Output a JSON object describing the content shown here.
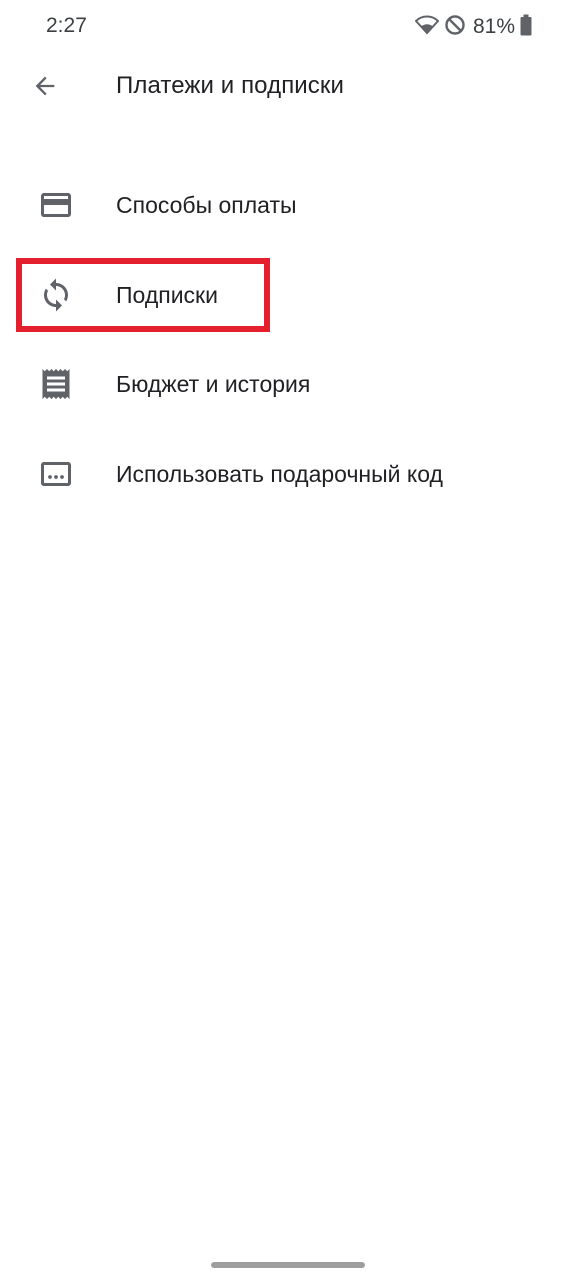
{
  "status_bar": {
    "time": "2:27",
    "battery": "81%",
    "icons": [
      "wifi-icon",
      "do-not-disturb-icon",
      "battery-icon"
    ]
  },
  "app_bar": {
    "back_icon": "arrow-back-icon",
    "title": "Платежи и подписки"
  },
  "menu": {
    "items": [
      {
        "label": "Способы оплаты",
        "icon": "credit-card-icon"
      },
      {
        "label": "Подписки",
        "icon": "sync-icon",
        "highlighted": true
      },
      {
        "label": "Бюджет и история",
        "icon": "receipt-icon"
      },
      {
        "label": "Использовать подарочный код",
        "icon": "redeem-code-icon"
      }
    ]
  },
  "colors": {
    "icon": "#5f6368",
    "text": "#202124",
    "highlight": "#e5202e",
    "background": "#ffffff"
  }
}
